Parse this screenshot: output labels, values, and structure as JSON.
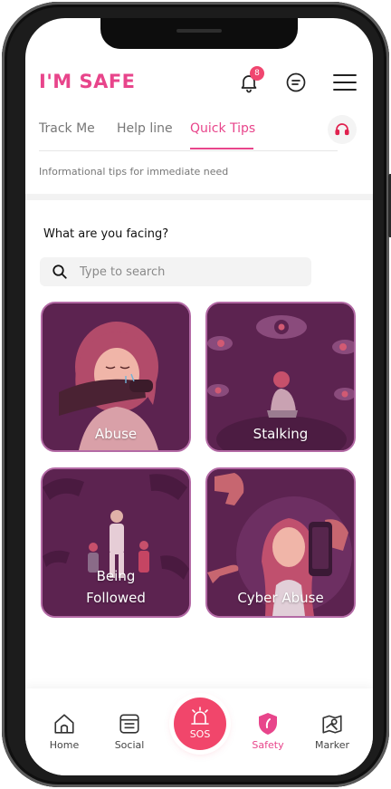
{
  "app": {
    "title": "I'M SAFE",
    "brand_color": "#e8458b",
    "notifications_count": "8"
  },
  "header": {
    "icons": [
      "bell-icon",
      "chat-icon",
      "menu-icon"
    ]
  },
  "tabs": [
    {
      "label": "Track Me",
      "active": false
    },
    {
      "label": "Help line",
      "active": false
    },
    {
      "label": "Quick Tips",
      "active": true
    }
  ],
  "info_text": "Informational tips for immediate need",
  "section": {
    "question": "What are you facing?",
    "search_placeholder": "Type to search"
  },
  "cards": [
    {
      "label": "Abuse"
    },
    {
      "label": "Stalking"
    },
    {
      "label": "Being Followed"
    },
    {
      "label": "Cyber Abuse"
    }
  ],
  "bottom_nav": {
    "home": "Home",
    "social": "Social",
    "sos": "SOS",
    "safety": "Safety",
    "marker": "Marker"
  },
  "colors": {
    "card_bg": "#5e2452",
    "card_border": "#b36aa5",
    "sos": "#f1466b"
  }
}
